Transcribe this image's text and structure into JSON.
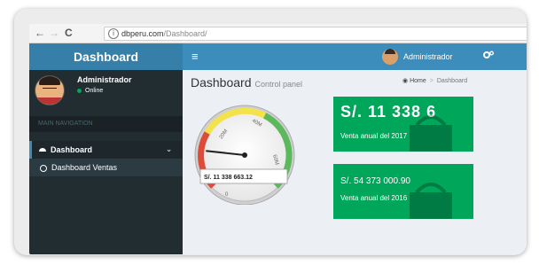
{
  "browser": {
    "back": "←",
    "forward": "→",
    "reload": "C",
    "info_icon": "i",
    "url_host": "dbperu.com",
    "url_path": "/Dashboard/"
  },
  "header": {
    "logo": "Dashboard",
    "menu_icon": "≡",
    "user_name": "Administrador",
    "settings_icon": "gears"
  },
  "sidebar": {
    "user_name": "Administrador",
    "user_status": "Online",
    "nav_header": "MAIN NAVIGATION",
    "items": [
      {
        "label": "Dashboard",
        "icon": "dashboard-icon",
        "chevron": "⌄"
      },
      {
        "label": "Dashboard Ventas",
        "icon": "circle-icon"
      }
    ]
  },
  "content": {
    "title": "Dashboard",
    "subtitle": "Control panel",
    "breadcrumb": {
      "home": "Home",
      "sep": ">",
      "current": "Dashboard"
    }
  },
  "gauge": {
    "value_text": "S/. 11 338 663.12",
    "ticks": [
      "0",
      "20M",
      "40M",
      "60M"
    ],
    "level_fraction": 0.19,
    "colors": {
      "low": "#dd4b39",
      "mid": "#f3e24a",
      "high": "#5cb85c"
    }
  },
  "cards": [
    {
      "value": "S/. 11 338 6",
      "label": "Venta anual del 2017",
      "color": "#00a65a"
    },
    {
      "value": "S/. 54 373 000.90",
      "label": "Venta anual del 2016",
      "color": "#00a65a"
    }
  ],
  "colors": {
    "header": "#3c8dbc",
    "logo": "#367fa9",
    "sidebar": "#222d32",
    "content_bg": "#ecf0f5"
  }
}
